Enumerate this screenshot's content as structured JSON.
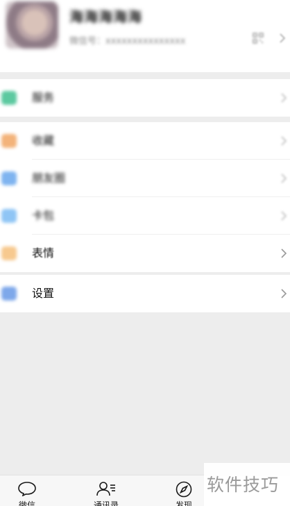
{
  "profile": {
    "nickname": "海海海海海",
    "wxid": "微信号：xxxxxxxxxxxxxxx"
  },
  "menu": [
    {
      "label": "服务",
      "icon": "service-icon",
      "color": "#5cc9a0"
    },
    {
      "label": "收藏",
      "icon": "favorites-icon",
      "color": "#f3b37a"
    },
    {
      "label": "朋友圈",
      "icon": "moments-icon",
      "color": "#7fb4f0"
    },
    {
      "label": "卡包",
      "icon": "card-wallet-icon",
      "color": "#8fc5f5"
    },
    {
      "label": "表情",
      "icon": "sticker-icon",
      "color": "#f7c98f"
    },
    {
      "label": "设置",
      "icon": "settings-icon",
      "color": "#7ea8ea"
    }
  ],
  "tabbar": {
    "tabs": [
      {
        "label": "微信",
        "icon": "chat-icon"
      },
      {
        "label": "通讯录",
        "icon": "contacts-icon"
      },
      {
        "label": "发现",
        "icon": "discover-compass-icon"
      }
    ]
  },
  "watermark": {
    "text": "软件技巧"
  }
}
